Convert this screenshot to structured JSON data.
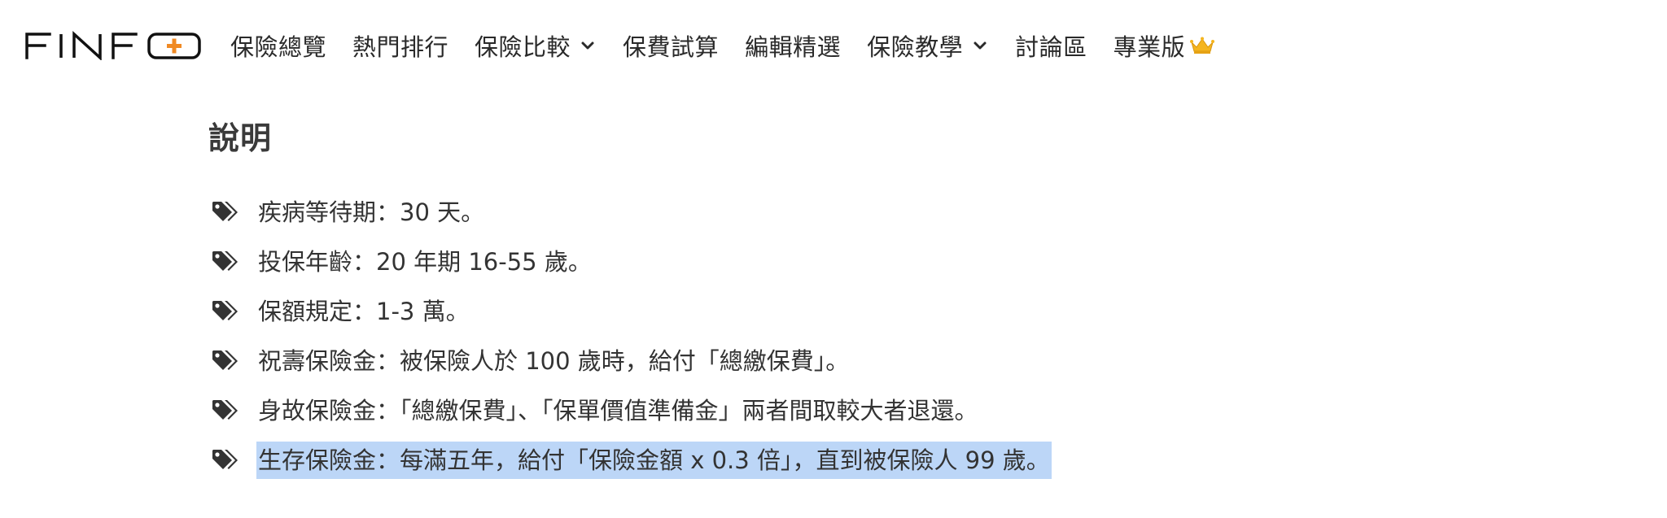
{
  "colors": {
    "text": "#2a2a2a",
    "logo_accent": "#f08a24",
    "selection": "#bcd6f7",
    "crown": "#f5b51f"
  },
  "header": {
    "logo_text": "FINFO",
    "nav": [
      {
        "label": "保險總覽",
        "has_dropdown": false
      },
      {
        "label": "熱門排行",
        "has_dropdown": false
      },
      {
        "label": "保險比較",
        "has_dropdown": true
      },
      {
        "label": "保費試算",
        "has_dropdown": false
      },
      {
        "label": "編輯精選",
        "has_dropdown": false
      },
      {
        "label": "保險教學",
        "has_dropdown": true
      },
      {
        "label": "討論區",
        "has_dropdown": false
      },
      {
        "label": "專業版",
        "has_dropdown": false,
        "icon": "crown-icon"
      }
    ]
  },
  "main": {
    "section_title": "說明",
    "items": [
      {
        "text": "疾病等待期：30 天。",
        "icon": "tags-icon",
        "selected": false
      },
      {
        "text": "投保年齡：20 年期 16-55 歲。",
        "icon": "tags-icon",
        "selected": false
      },
      {
        "text": "保額規定：1-3 萬。",
        "icon": "tags-icon",
        "selected": false
      },
      {
        "text": "祝壽保險金：被保險人於 100 歲時，給付「總繳保費」。",
        "icon": "tags-icon",
        "selected": false
      },
      {
        "text": "身故保險金：「總繳保費」、「保單價值準備金」兩者間取較大者退還。",
        "icon": "tags-icon",
        "selected": false
      },
      {
        "text": "生存保險金：每滿五年，給付「保險金額 x 0.3 倍」，直到被保險人 99 歲。",
        "icon": "tags-icon",
        "selected": true
      }
    ]
  }
}
